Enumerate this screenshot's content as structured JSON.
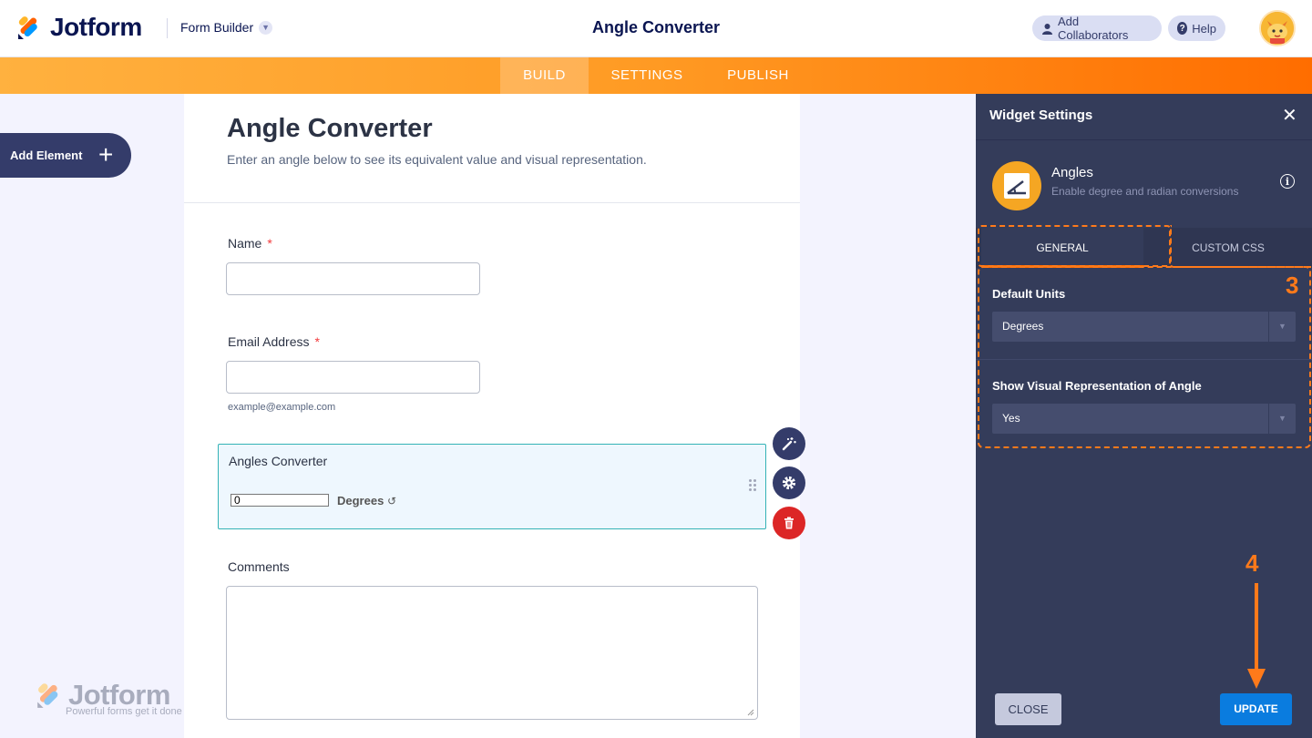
{
  "header": {
    "brand": "Jotform",
    "builder_label": "Form Builder",
    "title": "Angle Converter",
    "collaborators_label": "Add Collaborators",
    "help_label": "Help"
  },
  "nav": {
    "tabs": [
      {
        "label": "BUILD",
        "active": true
      },
      {
        "label": "SETTINGS",
        "active": false
      },
      {
        "label": "PUBLISH",
        "active": false
      }
    ]
  },
  "sidebar": {
    "add_element_label": "Add Element"
  },
  "form": {
    "title": "Angle Converter",
    "subtitle": "Enter an angle below to see its equivalent value and visual representation.",
    "fields": {
      "name_label": "Name",
      "email_label": "Email Address",
      "email_hint": "example@example.com",
      "widget_label": "Angles Converter",
      "angle_value": "0",
      "angle_unit": "Degrees",
      "comments_label": "Comments",
      "required_mark": "*"
    }
  },
  "panel": {
    "title": "Widget Settings",
    "widget_name": "Angles",
    "widget_desc": "Enable degree and radian conversions",
    "tabs": [
      {
        "label": "GENERAL",
        "active": true
      },
      {
        "label": "CUSTOM CSS",
        "active": false
      }
    ],
    "settings": [
      {
        "label": "Default Units",
        "value": "Degrees"
      },
      {
        "label": "Show Visual Representation of Angle",
        "value": "Yes"
      }
    ],
    "close_label": "CLOSE",
    "update_label": "UPDATE"
  },
  "annotations": {
    "step3": "3",
    "step4": "4"
  },
  "watermark": {
    "brand": "Jotform",
    "tagline": "Powerful forms get it done"
  },
  "colors": {
    "accent": "#ff6d00",
    "navy": "#0a1551",
    "panel": "#343c5a",
    "update": "#0a7cdf",
    "delete": "#dc2626"
  }
}
